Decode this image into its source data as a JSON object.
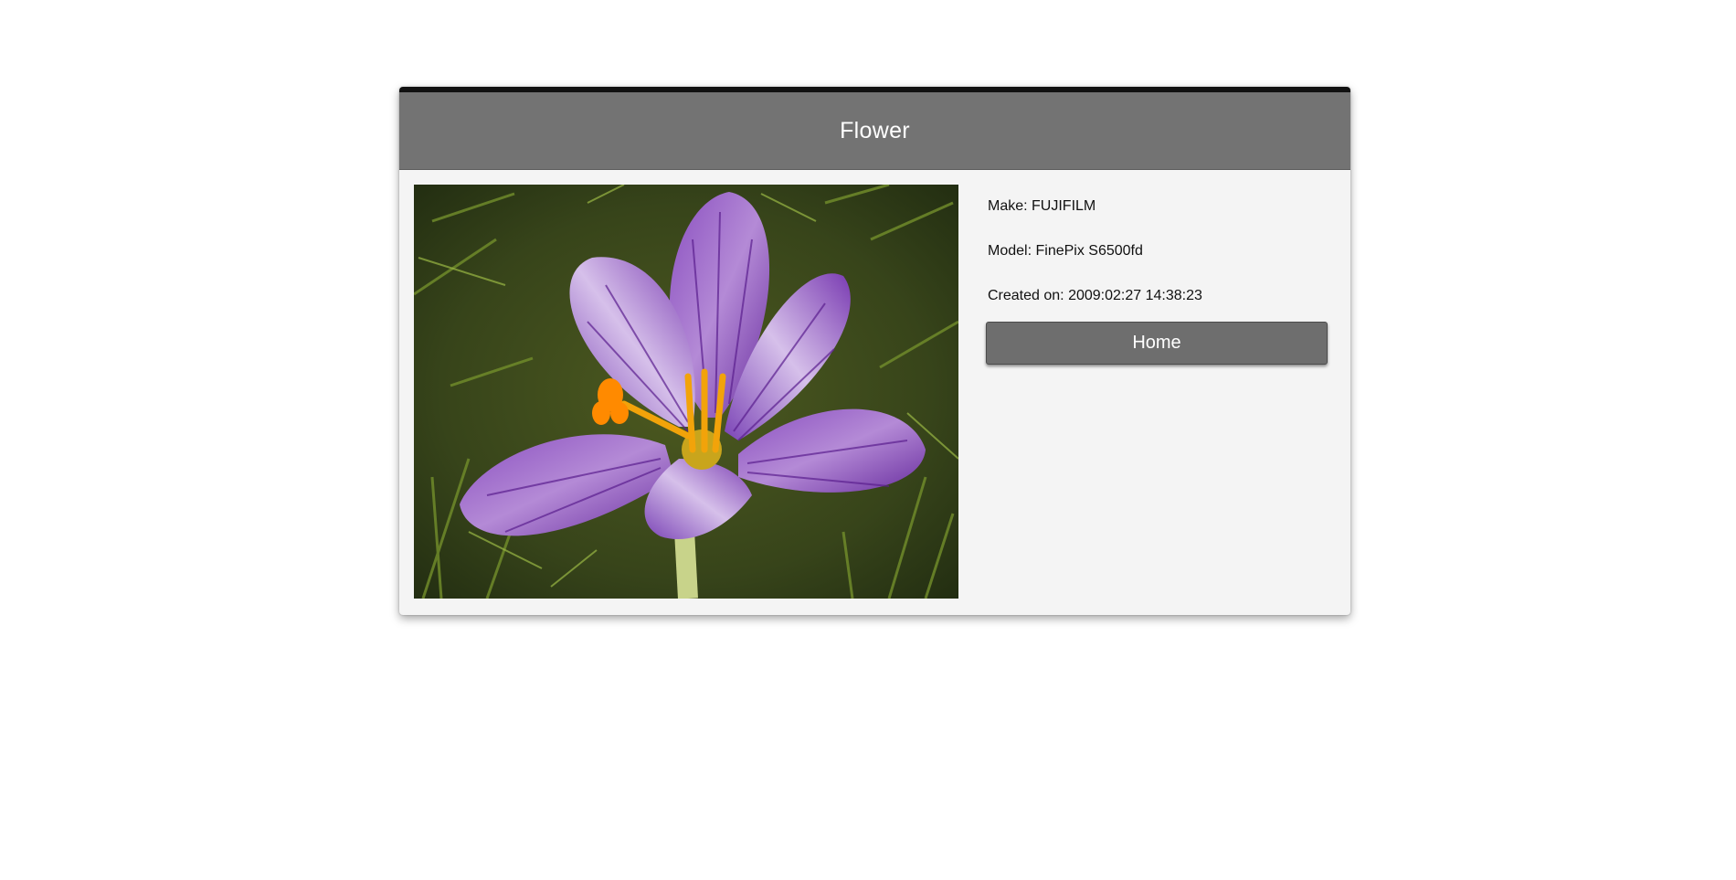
{
  "header": {
    "title": "Flower"
  },
  "photo": {
    "subject": "purple striped crocus flower on grass"
  },
  "details": {
    "make_label": "Make:",
    "make_value": "FUJIFILM",
    "model_label": "Model:",
    "model_value": "FinePix S6500fd",
    "created_label": "Created on:",
    "created_value": "2009:02:27 14:38:23"
  },
  "actions": {
    "home_label": "Home"
  },
  "colors": {
    "header_bg": "#737373",
    "card_bg": "#f4f4f4",
    "button_bg": "#6e6e6e",
    "top_border": "#111111"
  }
}
